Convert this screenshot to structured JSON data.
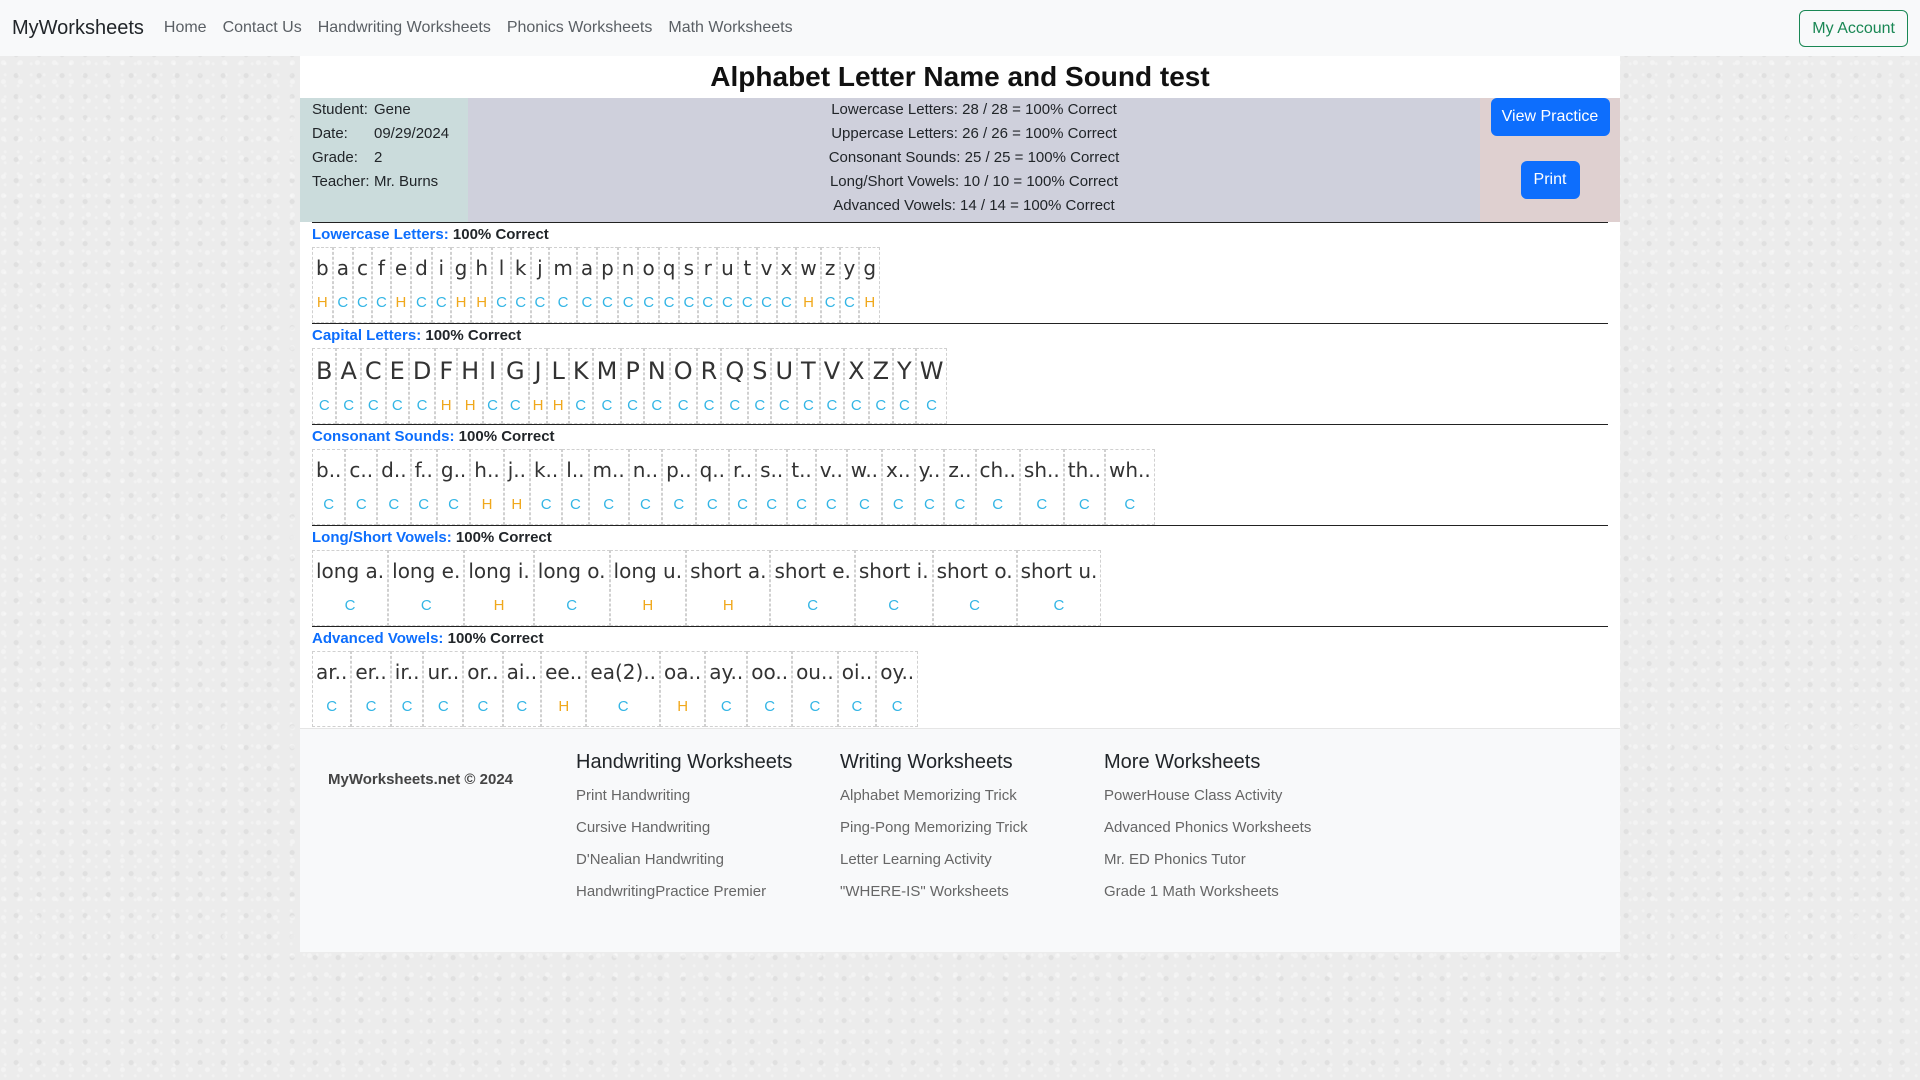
{
  "nav": {
    "brand": "MyWorksheets",
    "links": [
      "Home",
      "Contact Us",
      "Handwriting Worksheets",
      "Phonics Worksheets",
      "Math Worksheets"
    ],
    "account": "My Account"
  },
  "title": "Alphabet Letter Name and Sound test",
  "student": {
    "student_label": "Student:",
    "student": "Gene",
    "date_label": "Date:",
    "date": "09/29/2024",
    "grade_label": "Grade:",
    "grade": "2",
    "teacher_label": "Teacher:",
    "teacher": "Mr. Burns"
  },
  "scores": [
    "Lowercase Letters: 28 / 28 = 100% Correct",
    "Uppercase Letters: 26 / 26 = 100% Correct",
    "Consonant Sounds: 25 / 25 = 100% Correct",
    "Long/Short Vowels: 10 / 10 = 100% Correct",
    "Advanced Vowels: 14 / 14 = 100% Correct"
  ],
  "buttons": {
    "view": "View Practice",
    "print": "Print"
  },
  "sections": [
    {
      "name": "Lowercase Letters:",
      "result": "100% Correct",
      "style": "low",
      "items": [
        [
          "b",
          "H"
        ],
        [
          "a",
          "C"
        ],
        [
          "c",
          "C"
        ],
        [
          "f",
          "C"
        ],
        [
          "e",
          "H"
        ],
        [
          "d",
          "C"
        ],
        [
          "i",
          "C"
        ],
        [
          "g",
          "H"
        ],
        [
          "h",
          "H"
        ],
        [
          "l",
          "C"
        ],
        [
          "k",
          "C"
        ],
        [
          "j",
          "C"
        ],
        [
          "m",
          "C"
        ],
        [
          "a",
          "C"
        ],
        [
          "p",
          "C"
        ],
        [
          "n",
          "C"
        ],
        [
          "o",
          "C"
        ],
        [
          "q",
          "C"
        ],
        [
          "s",
          "C"
        ],
        [
          "r",
          "C"
        ],
        [
          "u",
          "C"
        ],
        [
          "t",
          "C"
        ],
        [
          "v",
          "C"
        ],
        [
          "x",
          "C"
        ],
        [
          "w",
          "H"
        ],
        [
          "z",
          "C"
        ],
        [
          "y",
          "C"
        ],
        [
          "g",
          "H"
        ]
      ]
    },
    {
      "name": "Capital Letters:",
      "result": "100% Correct",
      "style": "cap",
      "items": [
        [
          "B",
          "C"
        ],
        [
          "A",
          "C"
        ],
        [
          "C",
          "C"
        ],
        [
          "E",
          "C"
        ],
        [
          "D",
          "C"
        ],
        [
          "F",
          "H"
        ],
        [
          "H",
          "H"
        ],
        [
          "I",
          "C"
        ],
        [
          "G",
          "C"
        ],
        [
          "J",
          "H"
        ],
        [
          "L",
          "H"
        ],
        [
          "K",
          "C"
        ],
        [
          "M",
          "C"
        ],
        [
          "P",
          "C"
        ],
        [
          "N",
          "C"
        ],
        [
          "O",
          "C"
        ],
        [
          "R",
          "C"
        ],
        [
          "Q",
          "C"
        ],
        [
          "S",
          "C"
        ],
        [
          "U",
          "C"
        ],
        [
          "T",
          "C"
        ],
        [
          "V",
          "C"
        ],
        [
          "X",
          "C"
        ],
        [
          "Z",
          "C"
        ],
        [
          "Y",
          "C"
        ],
        [
          "W",
          "C"
        ]
      ]
    },
    {
      "name": "Consonant Sounds:",
      "result": "100% Correct",
      "style": "low",
      "items": [
        [
          "b..",
          "C"
        ],
        [
          "c..",
          "C"
        ],
        [
          "d..",
          "C"
        ],
        [
          "f..",
          "C"
        ],
        [
          "g..",
          "C"
        ],
        [
          "h..",
          "H"
        ],
        [
          "j..",
          "H"
        ],
        [
          "k..",
          "C"
        ],
        [
          "l..",
          "C"
        ],
        [
          "m..",
          "C"
        ],
        [
          "n..",
          "C"
        ],
        [
          "p..",
          "C"
        ],
        [
          "q..",
          "C"
        ],
        [
          "r..",
          "C"
        ],
        [
          "s..",
          "C"
        ],
        [
          "t..",
          "C"
        ],
        [
          "v..",
          "C"
        ],
        [
          "w..",
          "C"
        ],
        [
          "x..",
          "C"
        ],
        [
          "y..",
          "C"
        ],
        [
          "z..",
          "C"
        ],
        [
          "ch..",
          "C"
        ],
        [
          "sh..",
          "C"
        ],
        [
          "th..",
          "C"
        ],
        [
          "wh..",
          "C"
        ]
      ]
    },
    {
      "name": "Long/Short Vowels:",
      "result": "100% Correct",
      "style": "low",
      "items": [
        [
          "long a.",
          "C"
        ],
        [
          "long e.",
          "C"
        ],
        [
          "long i.",
          "H"
        ],
        [
          "long o.",
          "C"
        ],
        [
          "long u.",
          "H"
        ],
        [
          "short a.",
          "H"
        ],
        [
          "short e.",
          "C"
        ],
        [
          "short i.",
          "C"
        ],
        [
          "short o.",
          "C"
        ],
        [
          "short u.",
          "C"
        ]
      ]
    },
    {
      "name": "Advanced Vowels:",
      "result": "100% Correct",
      "style": "low",
      "items": [
        [
          "ar..",
          "C"
        ],
        [
          "er..",
          "C"
        ],
        [
          "ir..",
          "C"
        ],
        [
          "ur..",
          "C"
        ],
        [
          "or..",
          "C"
        ],
        [
          "ai..",
          "C"
        ],
        [
          "ee..",
          "H"
        ],
        [
          "ea(2)..",
          "C"
        ],
        [
          "oa..",
          "H"
        ],
        [
          "ay..",
          "C"
        ],
        [
          "oo..",
          "C"
        ],
        [
          "ou..",
          "C"
        ],
        [
          "oi..",
          "C"
        ],
        [
          "oy..",
          "C"
        ]
      ]
    }
  ],
  "footer": {
    "copyright": "MyWorksheets.net © 2024",
    "columns": [
      {
        "heading": "Handwriting Worksheets",
        "links": [
          "Print Handwriting",
          "Cursive Handwriting",
          "D'Nealian Handwriting",
          "HandwritingPractice Premier"
        ]
      },
      {
        "heading": "Writing Worksheets",
        "links": [
          "Alphabet Memorizing Trick",
          "Ping-Pong Memorizing Trick",
          "Letter Learning Activity",
          "\"WHERE-IS\" Worksheets"
        ]
      },
      {
        "heading": "More Worksheets",
        "links": [
          "PowerHouse Class Activity",
          "Advanced Phonics Worksheets",
          "Mr. ED Phonics Tutor",
          "Grade 1 Math Worksheets"
        ]
      }
    ]
  },
  "colors": {
    "primary": "#0d6efd",
    "correct": "#33b5e5",
    "help": "#f0a81c",
    "account": "#198754"
  }
}
